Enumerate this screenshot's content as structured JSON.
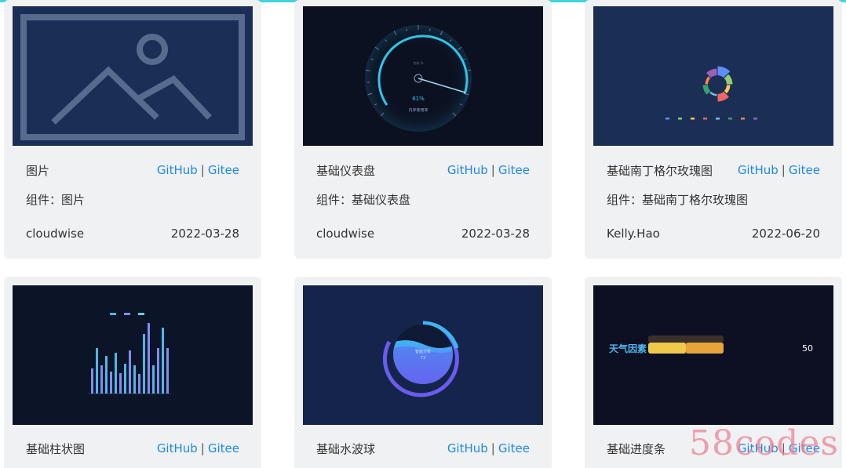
{
  "cards": [
    {
      "title": "图片",
      "github": "GitHub",
      "sep": "|",
      "gitee": "Gitee",
      "component": "组件：图片",
      "author": "cloudwise",
      "date": "2022-03-28"
    },
    {
      "title": "基础仪表盘",
      "github": "GitHub",
      "sep": "|",
      "gitee": "Gitee",
      "component": "组件：基础仪表盘",
      "author": "cloudwise",
      "date": "2022-03-28",
      "gauge": {
        "value": "61%",
        "label": "内存使用率",
        "unit": "内存 %"
      }
    },
    {
      "title": "基础南丁格尔玫瑰图",
      "github": "GitHub",
      "sep": "|",
      "gitee": "Gitee",
      "component": "组件：基础南丁格尔玫瑰图",
      "author": "Kelly.Hao",
      "date": "2022-06-20"
    },
    {
      "title": "基础柱状图",
      "github": "GitHub",
      "sep": "|",
      "gitee": "Gitee"
    },
    {
      "title": "基础水波球",
      "github": "GitHub",
      "sep": "|",
      "gitee": "Gitee",
      "liquid": {
        "label": "智能分析",
        "value": "73"
      }
    },
    {
      "title": "基础进度条",
      "github": "GitHub",
      "sep": "|",
      "gitee": "Gitee",
      "progress": {
        "label": "天气因素",
        "value": "50",
        "fraction": 0.5
      }
    }
  ],
  "watermark": "58codes",
  "colors": {
    "accent": "#1e88e5",
    "topbar": "#3fd3e0",
    "card_bg": "#f0f1f3"
  }
}
